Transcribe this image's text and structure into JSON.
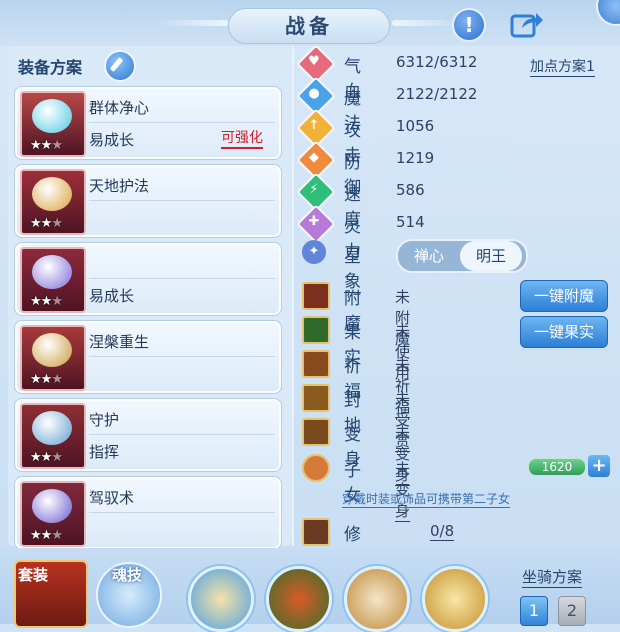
{
  "header": {
    "title": "战备"
  },
  "equipment": {
    "scheme_label": "装备方案",
    "cards": [
      {
        "line1": "群体净心",
        "line2": "易成长",
        "tag": "可强化",
        "stars": 2
      },
      {
        "line1": "天地护法",
        "line2": "",
        "tag": "",
        "stars": 2
      },
      {
        "line1": "",
        "line2": "易成长",
        "tag": "",
        "stars": 2
      },
      {
        "line1": "涅槃重生",
        "line2": "",
        "tag": "",
        "stars": 2
      },
      {
        "line1": "守护",
        "line2": "指挥",
        "tag": "",
        "stars": 2
      },
      {
        "line1": "驾驭术",
        "line2": "",
        "tag": "",
        "stars": 2
      }
    ]
  },
  "stats": {
    "add_point_scheme": "加点方案1",
    "items": [
      {
        "name": "气血",
        "value": "6312/6312",
        "icon": "heart-icon",
        "color": "#e46a7c"
      },
      {
        "name": "魔法",
        "value": "2122/2122",
        "icon": "mana-icon",
        "color": "#4aa2e8"
      },
      {
        "name": "攻击",
        "value": "1056",
        "icon": "sword-icon",
        "color": "#f2b23a"
      },
      {
        "name": "防御",
        "value": "1219",
        "icon": "shield-icon",
        "color": "#f08a3c"
      },
      {
        "name": "速度",
        "value": "586",
        "icon": "lightning-icon",
        "color": "#2fbf7a"
      },
      {
        "name": "灵力",
        "value": "514",
        "icon": "spirit-icon",
        "color": "#b77ad8"
      }
    ]
  },
  "star_sign": {
    "label": "星象",
    "options": [
      "禅心",
      "明王"
    ],
    "selected": "明王"
  },
  "properties": {
    "items": [
      {
        "name": "附魔",
        "value": "未附魔",
        "underline": false
      },
      {
        "name": "果实",
        "value": "未使用",
        "underline": false
      },
      {
        "name": "祈福",
        "value": "未祈福",
        "underline": true
      },
      {
        "name": "封地",
        "value": "未受赏",
        "underline": true
      },
      {
        "name": "变身",
        "value": "未变身",
        "underline": true
      },
      {
        "name": "子女",
        "value": "未变身",
        "underline": true
      }
    ],
    "btn_enchant": "一键附魔",
    "btn_fruit": "一键果实",
    "child_level": "1620",
    "child_tip": "穿戴时装或饰品可携带第二子女",
    "cultivation_label": "修炼觉醒",
    "cultivation_value": "0/8"
  },
  "bottom": {
    "suit_label": "套装",
    "soul_label": "魂技",
    "mount_label": "坐骑方案",
    "mount_options": [
      "1",
      "2"
    ]
  }
}
